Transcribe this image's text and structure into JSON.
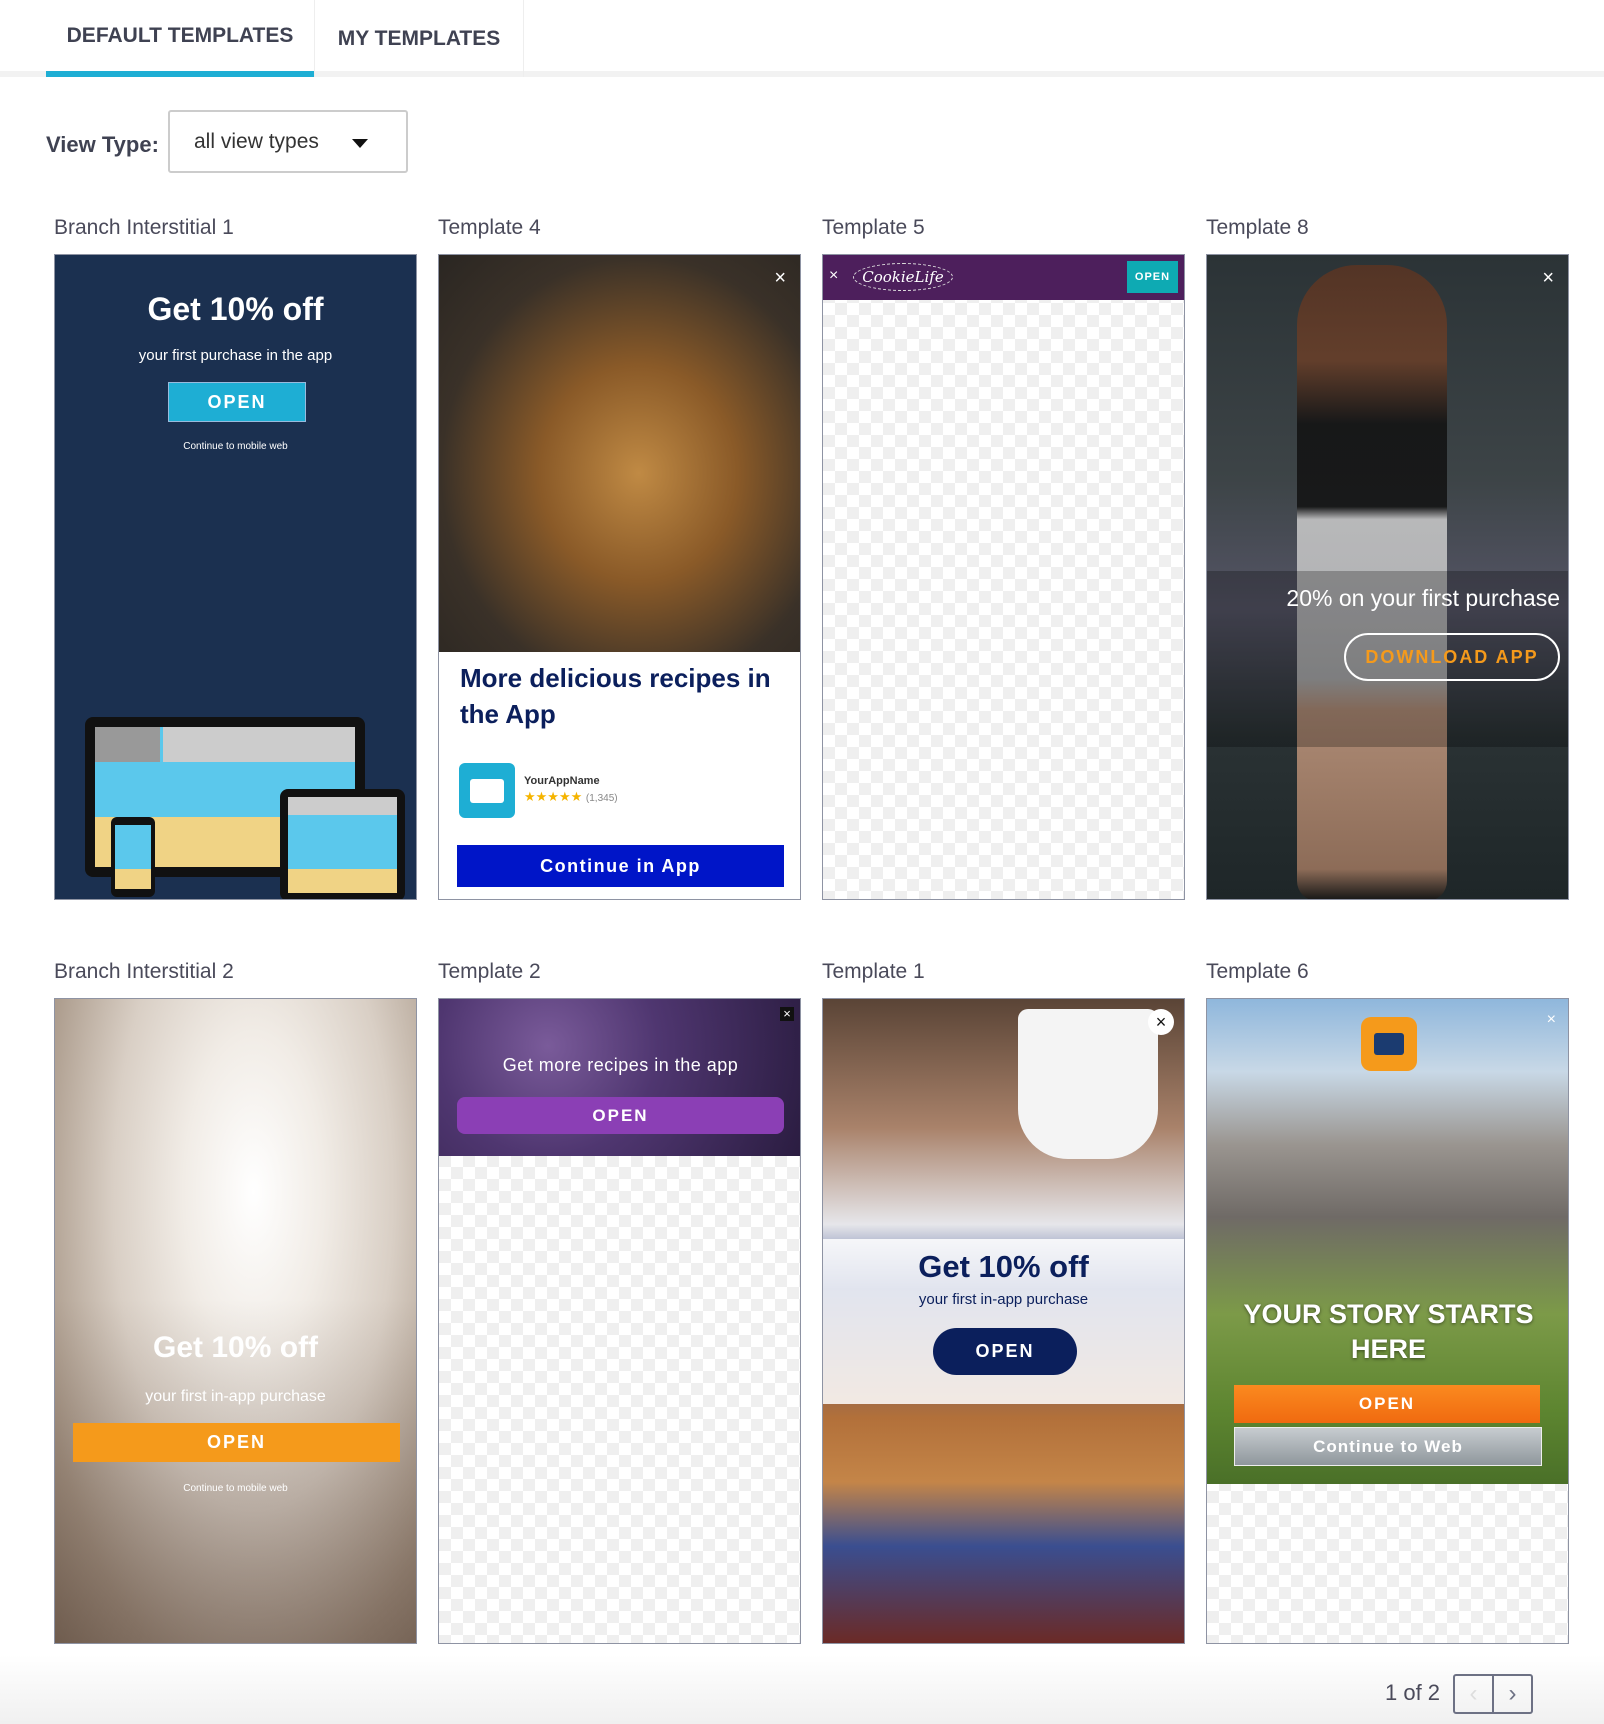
{
  "tabs": [
    {
      "label": "DEFAULT TEMPLATES",
      "active": true
    },
    {
      "label": "MY TEMPLATES",
      "active": false
    }
  ],
  "filter": {
    "label": "View Type:",
    "value": "all view types"
  },
  "colors": {
    "accent": "#1eaed4",
    "card_border": "#8e93a3"
  },
  "templates": [
    {
      "name": "Branch Interstitial 1",
      "title": "Get 10% off",
      "subtitle": "your first purchase in the app",
      "button": "OPEN",
      "link": "Continue to mobile web"
    },
    {
      "name": "Template 4",
      "close": "×",
      "title": "More delicious recipes in the App",
      "app_name": "YourAppName",
      "stars": "★★★★★",
      "rating": 5,
      "reviews": "(1,345)",
      "button": "Continue in App"
    },
    {
      "name": "Template 5",
      "close": "×",
      "logo": "CookieLife",
      "button": "OPEN"
    },
    {
      "name": "Template 8",
      "close": "×",
      "title": "20% on your first purchase",
      "button": "DOWNLOAD APP"
    },
    {
      "name": "Branch Interstitial 2",
      "title": "Get 10% off",
      "subtitle": "your first in-app purchase",
      "button": "OPEN",
      "link": "Continue to mobile web"
    },
    {
      "name": "Template 2",
      "close": "×",
      "title": "Get more recipes in the app",
      "button": "OPEN"
    },
    {
      "name": "Template 1",
      "close": "×",
      "title": "Get 10% off",
      "subtitle": "your first in-app purchase",
      "button": "OPEN"
    },
    {
      "name": "Template 6",
      "close": "×",
      "title": "YOUR STORY STARTS HERE",
      "button": "OPEN",
      "button2": "Continue to Web"
    }
  ],
  "pagination": {
    "text": "1 of 2",
    "prev": "‹",
    "next": "›"
  }
}
